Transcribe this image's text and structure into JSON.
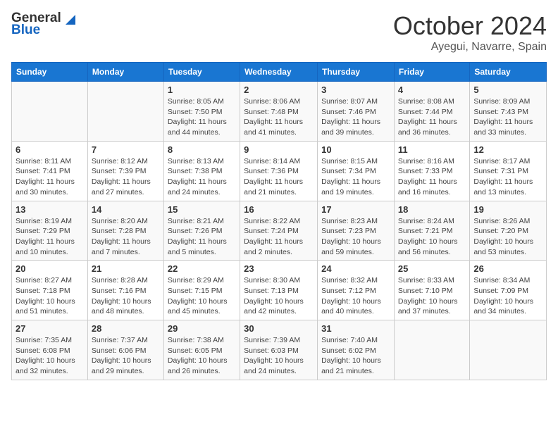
{
  "header": {
    "logo_general": "General",
    "logo_blue": "Blue",
    "month": "October 2024",
    "location": "Ayegui, Navarre, Spain"
  },
  "weekdays": [
    "Sunday",
    "Monday",
    "Tuesday",
    "Wednesday",
    "Thursday",
    "Friday",
    "Saturday"
  ],
  "weeks": [
    [
      {
        "day": "",
        "info": ""
      },
      {
        "day": "",
        "info": ""
      },
      {
        "day": "1",
        "info": "Sunrise: 8:05 AM\nSunset: 7:50 PM\nDaylight: 11 hours and 44 minutes."
      },
      {
        "day": "2",
        "info": "Sunrise: 8:06 AM\nSunset: 7:48 PM\nDaylight: 11 hours and 41 minutes."
      },
      {
        "day": "3",
        "info": "Sunrise: 8:07 AM\nSunset: 7:46 PM\nDaylight: 11 hours and 39 minutes."
      },
      {
        "day": "4",
        "info": "Sunrise: 8:08 AM\nSunset: 7:44 PM\nDaylight: 11 hours and 36 minutes."
      },
      {
        "day": "5",
        "info": "Sunrise: 8:09 AM\nSunset: 7:43 PM\nDaylight: 11 hours and 33 minutes."
      }
    ],
    [
      {
        "day": "6",
        "info": "Sunrise: 8:11 AM\nSunset: 7:41 PM\nDaylight: 11 hours and 30 minutes."
      },
      {
        "day": "7",
        "info": "Sunrise: 8:12 AM\nSunset: 7:39 PM\nDaylight: 11 hours and 27 minutes."
      },
      {
        "day": "8",
        "info": "Sunrise: 8:13 AM\nSunset: 7:38 PM\nDaylight: 11 hours and 24 minutes."
      },
      {
        "day": "9",
        "info": "Sunrise: 8:14 AM\nSunset: 7:36 PM\nDaylight: 11 hours and 21 minutes."
      },
      {
        "day": "10",
        "info": "Sunrise: 8:15 AM\nSunset: 7:34 PM\nDaylight: 11 hours and 19 minutes."
      },
      {
        "day": "11",
        "info": "Sunrise: 8:16 AM\nSunset: 7:33 PM\nDaylight: 11 hours and 16 minutes."
      },
      {
        "day": "12",
        "info": "Sunrise: 8:17 AM\nSunset: 7:31 PM\nDaylight: 11 hours and 13 minutes."
      }
    ],
    [
      {
        "day": "13",
        "info": "Sunrise: 8:19 AM\nSunset: 7:29 PM\nDaylight: 11 hours and 10 minutes."
      },
      {
        "day": "14",
        "info": "Sunrise: 8:20 AM\nSunset: 7:28 PM\nDaylight: 11 hours and 7 minutes."
      },
      {
        "day": "15",
        "info": "Sunrise: 8:21 AM\nSunset: 7:26 PM\nDaylight: 11 hours and 5 minutes."
      },
      {
        "day": "16",
        "info": "Sunrise: 8:22 AM\nSunset: 7:24 PM\nDaylight: 11 hours and 2 minutes."
      },
      {
        "day": "17",
        "info": "Sunrise: 8:23 AM\nSunset: 7:23 PM\nDaylight: 10 hours and 59 minutes."
      },
      {
        "day": "18",
        "info": "Sunrise: 8:24 AM\nSunset: 7:21 PM\nDaylight: 10 hours and 56 minutes."
      },
      {
        "day": "19",
        "info": "Sunrise: 8:26 AM\nSunset: 7:20 PM\nDaylight: 10 hours and 53 minutes."
      }
    ],
    [
      {
        "day": "20",
        "info": "Sunrise: 8:27 AM\nSunset: 7:18 PM\nDaylight: 10 hours and 51 minutes."
      },
      {
        "day": "21",
        "info": "Sunrise: 8:28 AM\nSunset: 7:16 PM\nDaylight: 10 hours and 48 minutes."
      },
      {
        "day": "22",
        "info": "Sunrise: 8:29 AM\nSunset: 7:15 PM\nDaylight: 10 hours and 45 minutes."
      },
      {
        "day": "23",
        "info": "Sunrise: 8:30 AM\nSunset: 7:13 PM\nDaylight: 10 hours and 42 minutes."
      },
      {
        "day": "24",
        "info": "Sunrise: 8:32 AM\nSunset: 7:12 PM\nDaylight: 10 hours and 40 minutes."
      },
      {
        "day": "25",
        "info": "Sunrise: 8:33 AM\nSunset: 7:10 PM\nDaylight: 10 hours and 37 minutes."
      },
      {
        "day": "26",
        "info": "Sunrise: 8:34 AM\nSunset: 7:09 PM\nDaylight: 10 hours and 34 minutes."
      }
    ],
    [
      {
        "day": "27",
        "info": "Sunrise: 7:35 AM\nSunset: 6:08 PM\nDaylight: 10 hours and 32 minutes."
      },
      {
        "day": "28",
        "info": "Sunrise: 7:37 AM\nSunset: 6:06 PM\nDaylight: 10 hours and 29 minutes."
      },
      {
        "day": "29",
        "info": "Sunrise: 7:38 AM\nSunset: 6:05 PM\nDaylight: 10 hours and 26 minutes."
      },
      {
        "day": "30",
        "info": "Sunrise: 7:39 AM\nSunset: 6:03 PM\nDaylight: 10 hours and 24 minutes."
      },
      {
        "day": "31",
        "info": "Sunrise: 7:40 AM\nSunset: 6:02 PM\nDaylight: 10 hours and 21 minutes."
      },
      {
        "day": "",
        "info": ""
      },
      {
        "day": "",
        "info": ""
      }
    ]
  ]
}
